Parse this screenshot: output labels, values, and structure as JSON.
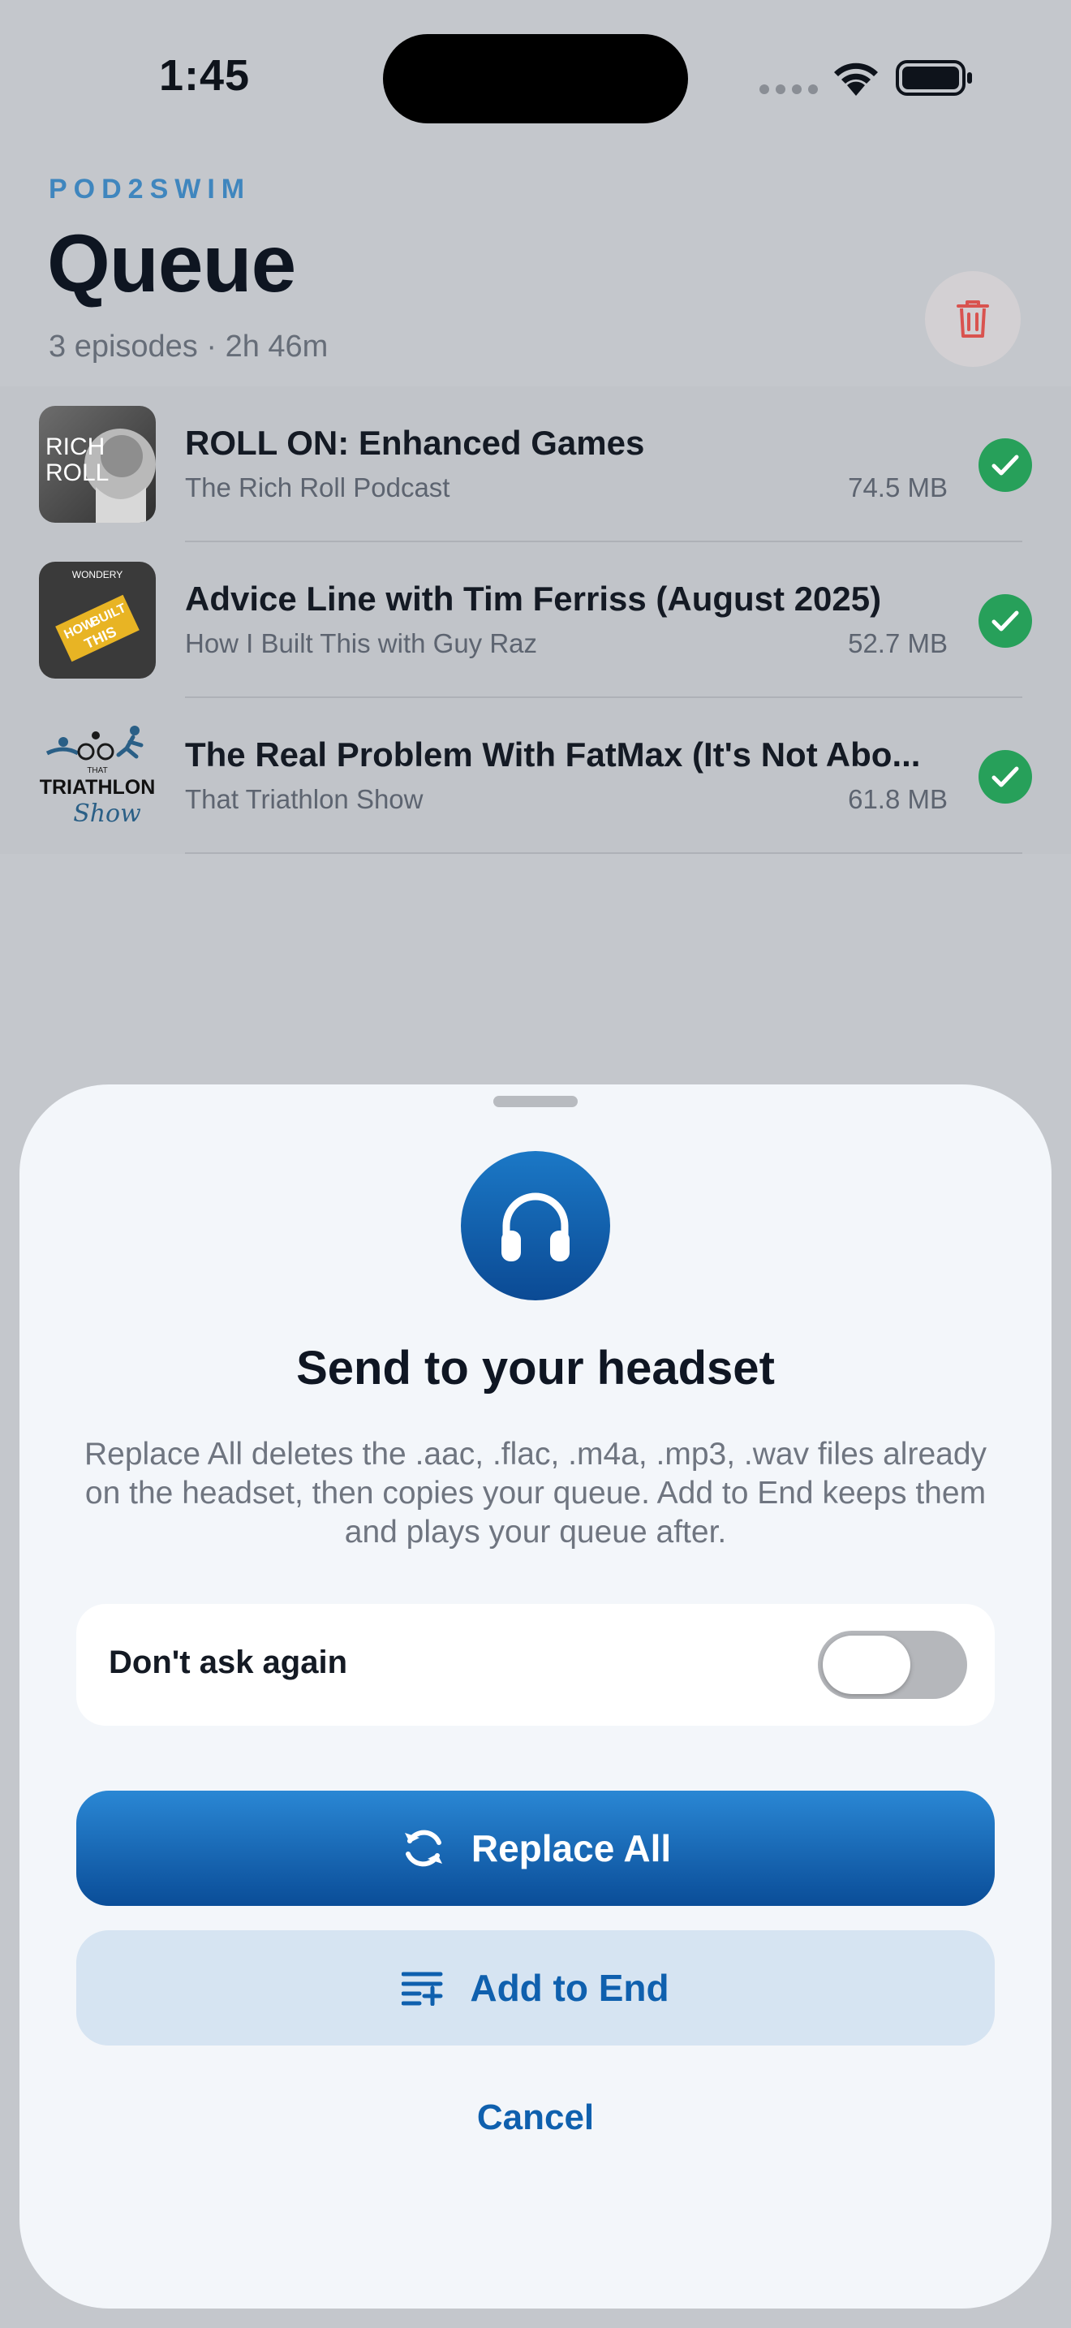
{
  "status_bar": {
    "time": "1:45"
  },
  "header": {
    "brand": "POD2SWIM",
    "title": "Queue",
    "summary": "3 episodes · 2h 46m"
  },
  "icons": {
    "trash": "trash-icon",
    "check": "checkmark-icon",
    "headset": "headphones-icon",
    "replace": "sync-arrows-icon",
    "add": "list-add-icon"
  },
  "colors": {
    "accent": "#0b5aa6",
    "check": "#27a05a",
    "trash": "#d9534f",
    "brand": "#3f86be"
  },
  "episodes": [
    {
      "title": "ROLL ON: Enhanced Games",
      "show": "The Rich Roll Podcast",
      "size": "74.5 MB",
      "art": {
        "line1": "RICH",
        "line2": "ROLL"
      }
    },
    {
      "title": "Advice Line with Tim Ferriss (August 2025)",
      "show": "How I Built This with Guy Raz",
      "size": "52.7 MB",
      "art": {
        "top": "WONDERY",
        "line1": "HOW",
        "line2": "BUILT",
        "line3": "THIS"
      }
    },
    {
      "title": "The Real Problem With FatMax (It's Not Abo...",
      "show": "That Triathlon Show",
      "size": "61.8 MB",
      "art": {
        "small": "THAT",
        "line1": "TRIATHLON",
        "line2": "Show"
      }
    }
  ],
  "sheet": {
    "title": "Send to your headset",
    "message": "Replace All deletes the .aac, .flac, .m4a, .mp3, .wav files already on the headset, then copies your queue. Add to End keeps them and plays your queue after.",
    "toggle_label": "Don't ask again",
    "toggle_on": false,
    "replace_label": "Replace All",
    "add_label": "Add to End",
    "cancel_label": "Cancel"
  }
}
